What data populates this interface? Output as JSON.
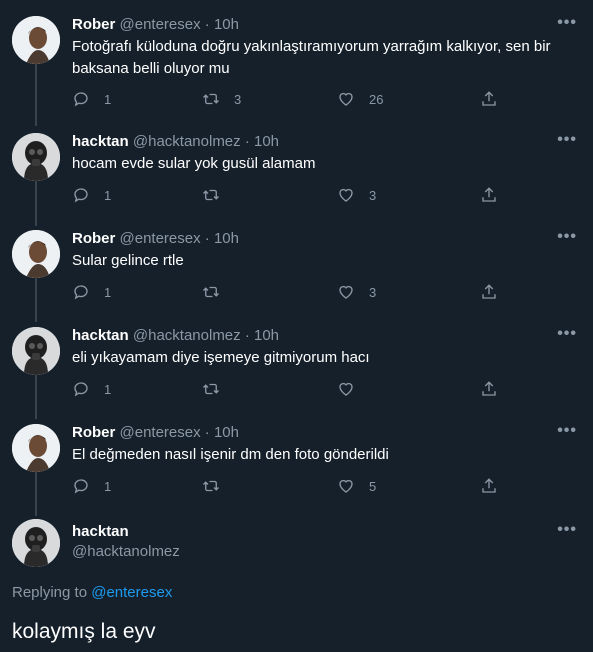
{
  "users": {
    "rober": {
      "name": "Rober",
      "handle": "@enteresex"
    },
    "hacktan": {
      "name": "hacktan",
      "handle": "@hacktanolmez"
    }
  },
  "more_glyph": "•••",
  "tweets": [
    {
      "name": "Rober",
      "handle": "@enteresex",
      "time": "· 10h",
      "text": "Fotoğrafı küloduna doğru yakınlaştıramıyorum yarrağım kalkıyor,  sen bir baksana belli oluyor mu",
      "replies": "1",
      "retweets": "3",
      "likes": "26"
    },
    {
      "name": "hacktan",
      "handle": "@hacktanolmez",
      "time": "· 10h",
      "text": "hocam evde sular yok gusül alamam",
      "replies": "1",
      "retweets": "",
      "likes": "3"
    },
    {
      "name": "Rober",
      "handle": "@enteresex",
      "time": "· 10h",
      "text": "Sular gelince rtle",
      "replies": "1",
      "retweets": "",
      "likes": "3"
    },
    {
      "name": "hacktan",
      "handle": "@hacktanolmez",
      "time": "· 10h",
      "text": "eli yıkayamam diye işemeye gitmiyorum hacı",
      "replies": "1",
      "retweets": "",
      "likes": ""
    },
    {
      "name": "Rober",
      "handle": "@enteresex",
      "time": "· 10h",
      "text": "El değmeden nasıl işenir dm den foto gönderildi",
      "replies": "1",
      "retweets": "",
      "likes": "5"
    }
  ],
  "main_tweet": {
    "name": "hacktan",
    "handle": "@hacktanolmez",
    "replying_prefix": "Replying to",
    "replying_to": "@enteresex",
    "text": "kolaymış la eyv"
  },
  "colors": {
    "background": "#15202b",
    "accent": "#1d9bf0",
    "muted": "#8b98a5",
    "thread_line": "#38444d"
  }
}
